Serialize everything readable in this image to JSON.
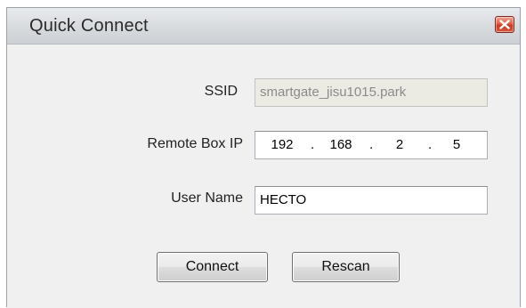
{
  "window": {
    "title": "Quick Connect",
    "close_icon": "close-icon"
  },
  "form": {
    "ssid": {
      "label": "SSID",
      "value": "smartgate_jisu1015.park",
      "disabled": true
    },
    "remote_box_ip": {
      "label": "Remote Box IP",
      "octets": [
        "192",
        "168",
        "2",
        "5"
      ],
      "separator": "."
    },
    "user_name": {
      "label": "User Name",
      "value": "HECTO"
    }
  },
  "buttons": {
    "connect": "Connect",
    "rescan": "Rescan"
  },
  "colors": {
    "close_button": "#d9533a",
    "dialog_background": "#f0f0f0",
    "disabled_field": "#ebebe4"
  }
}
